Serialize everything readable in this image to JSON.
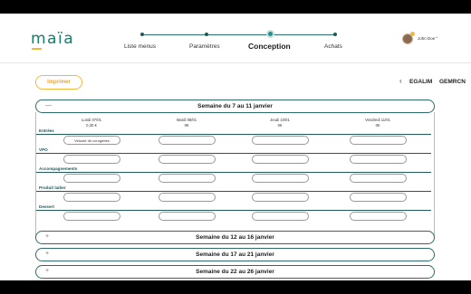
{
  "app": {
    "logo": "maïa"
  },
  "stepper": {
    "steps": [
      {
        "label": "Liste menus"
      },
      {
        "label": "Paramètres"
      },
      {
        "label": "Conception"
      },
      {
        "label": "Achats"
      }
    ],
    "active_index": 2
  },
  "user": {
    "name": "John Doe"
  },
  "toolbar": {
    "print_label": "Imprimer",
    "tabs": [
      "EGALIM",
      "GEMRCN"
    ]
  },
  "weeks": [
    {
      "title": "Semaine du 7 au 11 janvier",
      "toggle": "—",
      "days": [
        {
          "name": "Lundi 07/01",
          "cost": "0,30 €"
        },
        {
          "name": "Mardi 08/01",
          "cost": "0€"
        },
        {
          "name": "Jeudi 10/01",
          "cost": "0€"
        },
        {
          "name": "Vendredi 11/01",
          "cost": "0€"
        }
      ],
      "categories": [
        {
          "label": "Entrées",
          "values": [
            "Velouté de courgettes",
            "",
            "",
            ""
          ]
        },
        {
          "label": "VPO",
          "values": [
            "",
            "",
            "",
            ""
          ]
        },
        {
          "label": "Accompagnements",
          "values": [
            "",
            "",
            "",
            ""
          ]
        },
        {
          "label": "Produit laitier",
          "values": [
            "",
            "",
            "",
            ""
          ]
        },
        {
          "label": "Dessert",
          "values": [
            "",
            "",
            "",
            ""
          ]
        }
      ]
    },
    {
      "title": "Semaine du 12 au 16 janvier",
      "toggle": "+"
    },
    {
      "title": "Semaine du 17 au 21 janvier",
      "toggle": "+"
    },
    {
      "title": "Semaine du 22 au 26 janvier",
      "toggle": "+"
    }
  ],
  "colors": {
    "brand": "#1a7a6a",
    "accent": "#f5b73b",
    "dark_teal": "#1d5a5a"
  }
}
